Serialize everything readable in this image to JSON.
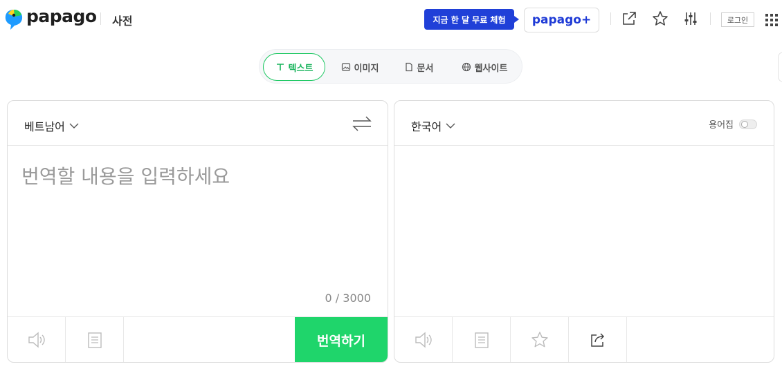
{
  "header": {
    "logo_text": "papago",
    "dict_label": "사전",
    "promo_label": "지금 한 달 무료 체험",
    "plus_label": "papago+",
    "login_label": "로그인"
  },
  "modes": [
    {
      "label": "텍스트",
      "icon": "text-icon",
      "active": true
    },
    {
      "label": "이미지",
      "icon": "image-icon",
      "active": false
    },
    {
      "label": "문서",
      "icon": "document-icon",
      "active": false
    },
    {
      "label": "웹사이트",
      "icon": "globe-icon",
      "active": false
    }
  ],
  "source": {
    "language": "베트남어",
    "placeholder": "번역할 내용을 입력하세요",
    "value": "",
    "counter": "0 / 3000",
    "translate_label": "번역하기"
  },
  "target": {
    "language": "한국어",
    "glossary_label": "용어집",
    "glossary_enabled": false
  },
  "colors": {
    "accent": "#1fd56b",
    "brand_blue": "#2040d8",
    "tab_active": "#16b35a"
  }
}
